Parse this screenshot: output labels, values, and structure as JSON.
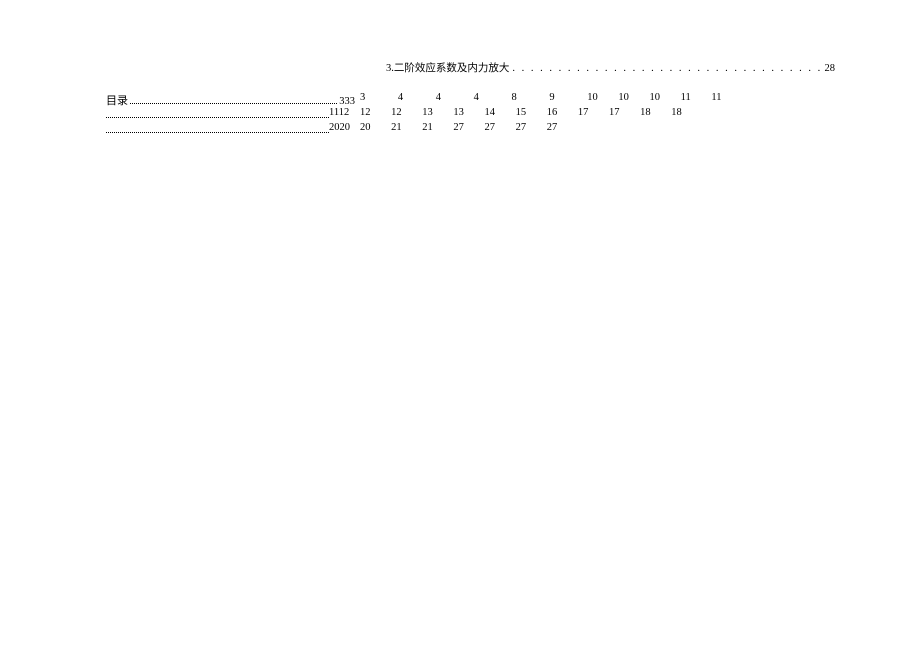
{
  "section": {
    "label": "3.二阶效应系数及内力放大",
    "dots": ". . . . . . . . . . . . . . . . . . . . . . . . . . . . . . . . . . . . . . . . . . . . . . . . . . . . .",
    "page": "28"
  },
  "toc": {
    "label": "目录",
    "num_0": "333"
  },
  "rows": {
    "r1": [
      "3",
      "4",
      "4",
      "4",
      "8",
      "9",
      "10",
      "10",
      "10",
      "11",
      "11"
    ],
    "r2_left": "1112",
    "r2": [
      "12",
      "12",
      "13",
      "13",
      "14",
      "15",
      "16",
      "17",
      "17",
      "18",
      "18"
    ],
    "r3_left": "2020",
    "r3": [
      "20",
      "21",
      "21",
      "27",
      "27",
      "27",
      "27"
    ]
  }
}
